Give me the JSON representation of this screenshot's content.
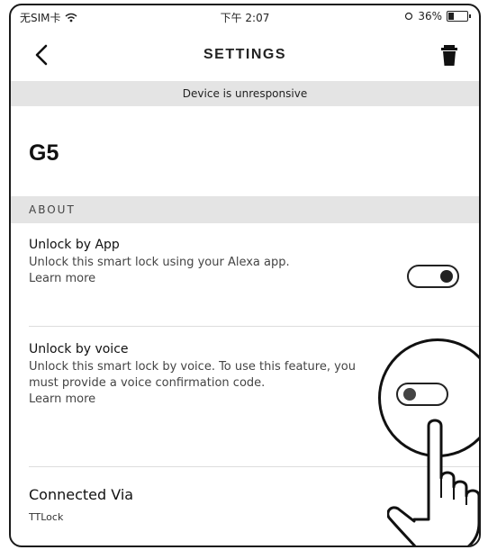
{
  "status_bar": {
    "carrier": "无SIM卡",
    "time": "下午 2:07",
    "battery_text": "36%",
    "battery_level": 0.36
  },
  "nav": {
    "title": "SETTINGS",
    "back_icon": "chevron-left-icon",
    "delete_icon": "trash-icon"
  },
  "banner": {
    "text": "Device is unresponsive"
  },
  "device": {
    "name": "G5"
  },
  "section": {
    "about_label": "ABOUT"
  },
  "settings": [
    {
      "title": "Unlock by App",
      "description": "Unlock this smart lock using your Alexa app.",
      "learn_more": "Learn more",
      "enabled": true
    },
    {
      "title": "Unlock by voice",
      "description": "Unlock this smart lock by voice. To use this feature, you must provide a voice confirmation code.",
      "learn_more": "Learn more",
      "enabled": false
    }
  ],
  "connected": {
    "label": "Connected Via",
    "value": "TTLock"
  },
  "colors": {
    "banner_bg": "#e4e4e4",
    "text": "#222222",
    "divider": "#dddddd"
  }
}
